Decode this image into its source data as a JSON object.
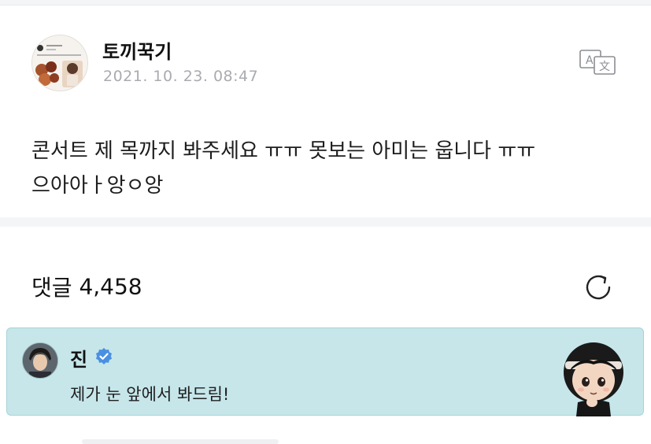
{
  "post": {
    "author": "토끼꾹기",
    "timestamp": "2021. 10. 23. 08:47",
    "body_line1": "콘서트 제 목까지 봐주세요 ㅠㅠ 못보는 아미는 웁니다 ㅠㅠ",
    "body_line2": "으아아ㅏ앙ㅇ앙",
    "translate_icon": "translate-icon"
  },
  "comments": {
    "label": "댓글",
    "count": "4,458",
    "refresh_icon": "refresh-icon"
  },
  "artist_comment": {
    "name": "진",
    "text": "제가 눈 앞에서 봐드림!",
    "verified_icon": "verified-badge-icon",
    "background": "#c6e6ea",
    "badge_color": "#4a90e2"
  }
}
